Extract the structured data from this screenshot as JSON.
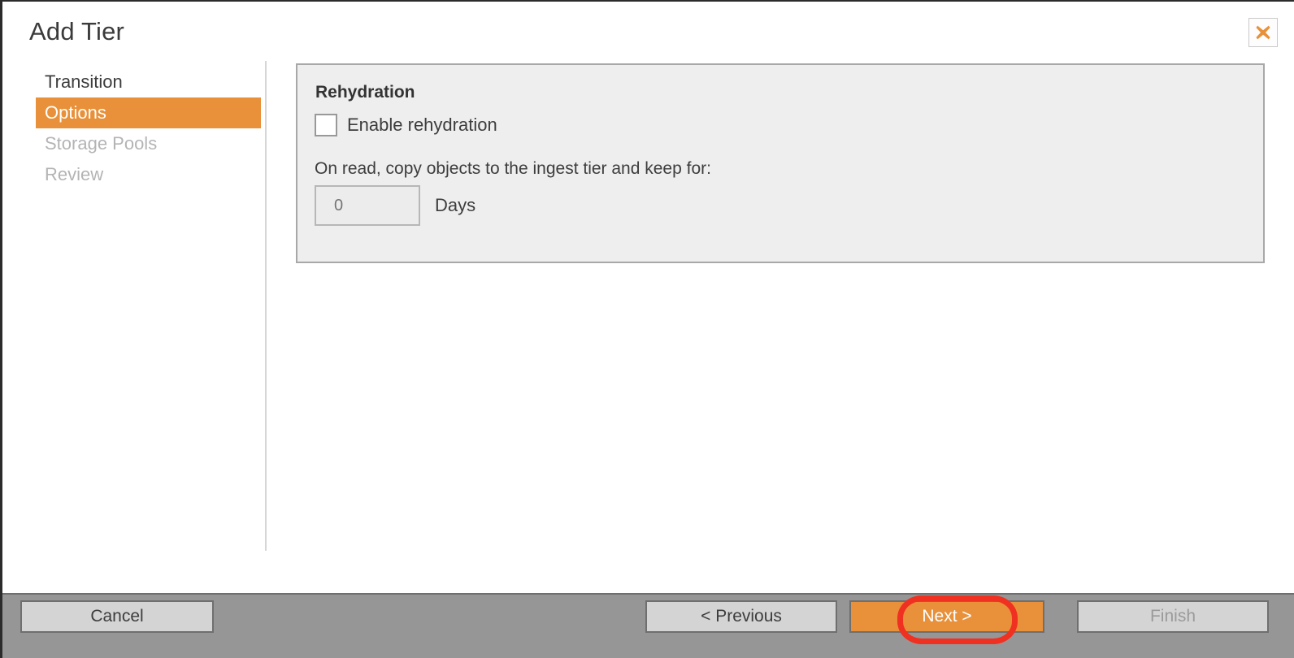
{
  "dialog": {
    "title": "Add Tier",
    "close_icon": "close-x-icon"
  },
  "wizard_nav": {
    "items": [
      {
        "label": "Transition",
        "state": "done"
      },
      {
        "label": "Options",
        "state": "active"
      },
      {
        "label": "Storage Pools",
        "state": "disabled"
      },
      {
        "label": "Review",
        "state": "disabled"
      }
    ]
  },
  "options_panel": {
    "section_heading": "Rehydration",
    "enable_rehydration": {
      "label": "Enable rehydration",
      "checked": false
    },
    "keep_for_description": "On read, copy objects to the ingest tier and keep for:",
    "days_field": {
      "value": "0",
      "placeholder": "0",
      "unit_label": "Days",
      "enabled": false
    }
  },
  "footer": {
    "cancel_label": "Cancel",
    "previous_label": "< Previous",
    "next_label": "Next >",
    "finish_label": "Finish",
    "finish_disabled": true
  },
  "colors": {
    "accent_orange": "#e8913a",
    "footer_gray": "#969696",
    "panel_gray": "#eeeeee",
    "button_gray": "#d4d4d4",
    "annotation_red": "#f03020",
    "disabled_text": "#b4b4b4"
  },
  "annotations": {
    "next_highlight": "red-ellipse-around-next-button"
  }
}
